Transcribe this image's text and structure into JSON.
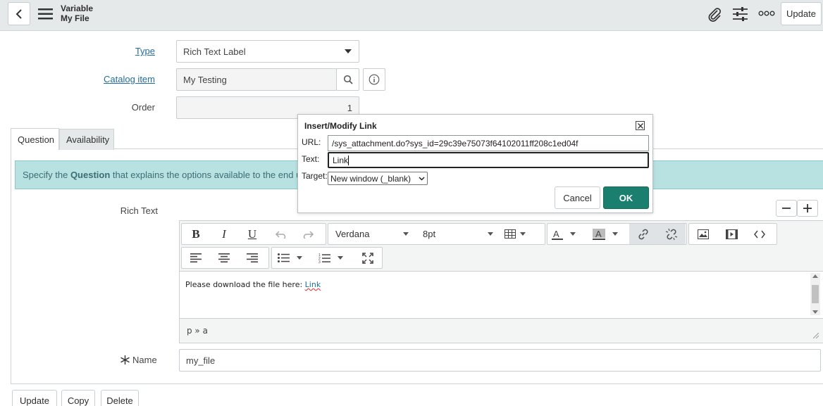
{
  "header": {
    "title_line1": "Variable",
    "title_line2": "My File",
    "update_label": "Update"
  },
  "form": {
    "type_label": "Type",
    "type_value": "Rich Text Label",
    "catalog_item_label": "Catalog item",
    "catalog_item_value": "My Testing",
    "order_label": "Order",
    "order_value": "1",
    "name_label": "Name",
    "name_value": "my_file"
  },
  "tabs": [
    {
      "label": "Question"
    },
    {
      "label": "Availability"
    }
  ],
  "info_bar": {
    "prefix": "Specify the ",
    "bold": "Question",
    "suffix": " that explains the options available to the end user w"
  },
  "rich_text": {
    "label": "Rich Text",
    "font_family": "Verdana",
    "font_size": "8pt",
    "content_prefix": "Please download the file here: ",
    "content_link": "Link",
    "status_path": "p » a"
  },
  "dialog": {
    "title": "Insert/Modify Link",
    "url_label": "URL:",
    "url_value": "/sys_attachment.do?sys_id=29c39e75073f64102011ff208c1ed04f",
    "text_label": "Text:",
    "text_value": "Link",
    "target_label": "Target:",
    "target_value": "New window (_blank)",
    "cancel_label": "Cancel",
    "ok_label": "OK"
  },
  "bottom_buttons": [
    {
      "label": "Update"
    },
    {
      "label": "Copy"
    },
    {
      "label": "Delete"
    }
  ],
  "colors": {
    "ok_button": "#1a7f6e",
    "info_bar": "#b8e2e1",
    "link": "#1f6d9c"
  }
}
